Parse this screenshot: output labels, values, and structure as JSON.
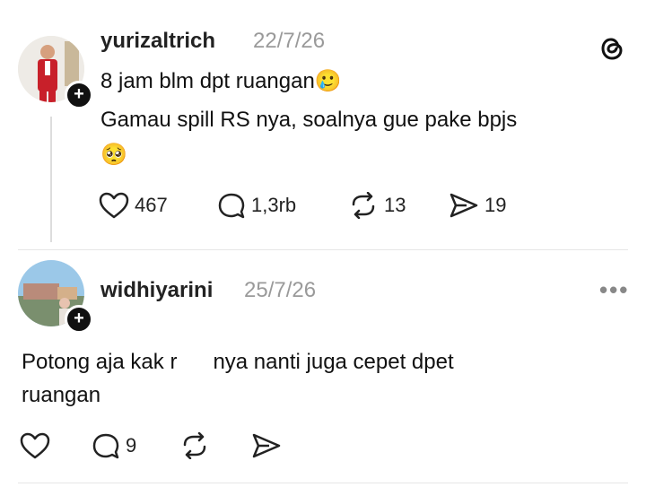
{
  "post1": {
    "username": "yurizaltrich",
    "date": "22/7/26",
    "line1": "8 jam blm dpt ruangan🥲",
    "line2": "Gamau spill RS nya, soalnya gue pake bpjs",
    "line3": "🥺",
    "likes": "467",
    "replies": "1,3rb",
    "reposts": "13",
    "shares": "19"
  },
  "post2": {
    "username": "widhiyarini",
    "date": "25/7/26",
    "text_before": "Potong aja kak r",
    "text_after": "nya nanti juga cepet dpet",
    "line2": "ruangan",
    "replies": "9",
    "more": "•••"
  },
  "colors": {
    "text": "#111111",
    "muted": "#9a9a9a",
    "divider": "#e6e6e6"
  }
}
